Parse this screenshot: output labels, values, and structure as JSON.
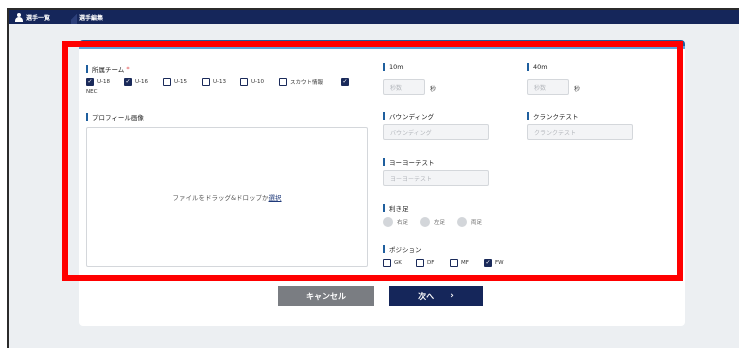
{
  "breadcrumb": {
    "item1": "選手一覧",
    "item2": "選手編集"
  },
  "team": {
    "label": "所属チーム",
    "required_mark": "*",
    "options": [
      {
        "label": "U-18",
        "checked": true
      },
      {
        "label": "U-16",
        "checked": true
      },
      {
        "label": "U-15",
        "checked": false
      },
      {
        "label": "U-13",
        "checked": false
      },
      {
        "label": "U-10",
        "checked": false
      },
      {
        "label": "スカウト情報",
        "checked": false
      },
      {
        "label": "NEC",
        "checked": true
      }
    ]
  },
  "profile_image": {
    "label": "プロフィール画像",
    "drop_text": "ファイルをドラッグ&ドロップか",
    "select_link": "選択"
  },
  "run10m": {
    "label": "10m",
    "placeholder": "秒数",
    "unit": "秒"
  },
  "run40m": {
    "label": "40m",
    "placeholder": "秒数",
    "unit": "秒"
  },
  "bounding": {
    "label": "バウンディング",
    "placeholder": "バウンディング"
  },
  "crank": {
    "label": "クランクテスト",
    "placeholder": "クランクテスト"
  },
  "yoyo": {
    "label": "ヨーヨーテスト",
    "placeholder": "ヨーヨーテスト"
  },
  "foot": {
    "label": "利き足",
    "options": [
      {
        "label": "右足"
      },
      {
        "label": "左足"
      },
      {
        "label": "両足"
      }
    ]
  },
  "position": {
    "label": "ポジション",
    "options": [
      {
        "label": "GK",
        "checked": false
      },
      {
        "label": "DF",
        "checked": false
      },
      {
        "label": "MF",
        "checked": false
      },
      {
        "label": "FW",
        "checked": true
      }
    ]
  },
  "buttons": {
    "cancel": "キャンセル",
    "next": "次へ",
    "next_arrow": "›"
  },
  "icons": {
    "check": "✓",
    "breadcrumb_icon": "person-icon"
  },
  "colors": {
    "header": "#15265a",
    "accent": "#1f5f9e",
    "highlight": "#ff0000",
    "cancel": "#7a7d82"
  }
}
